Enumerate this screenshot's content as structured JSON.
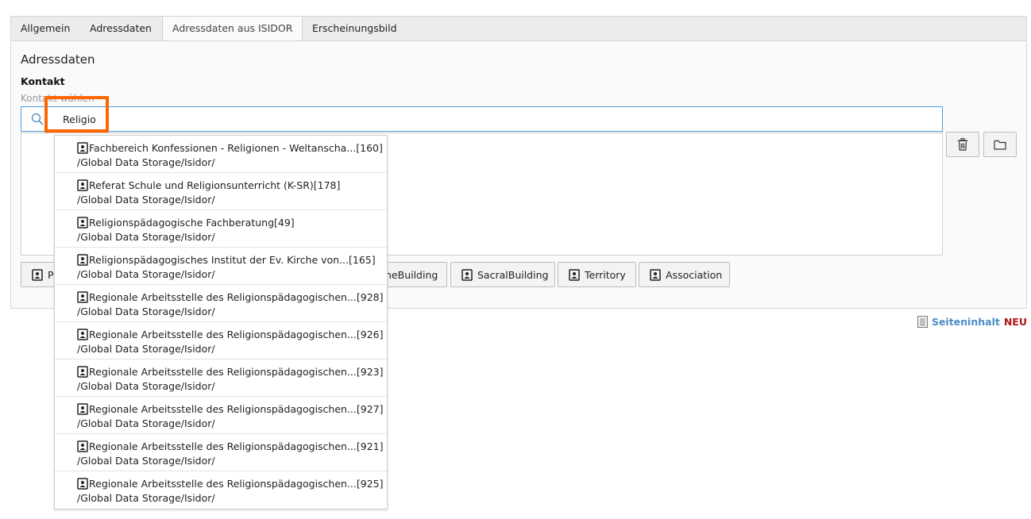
{
  "tabs": [
    {
      "label": "Allgemein"
    },
    {
      "label": "Adressdaten"
    },
    {
      "label": "Adressdaten aus ISIDOR"
    },
    {
      "label": "Erscheinungsbild"
    }
  ],
  "section": {
    "title": "Adressdaten"
  },
  "field": {
    "label": "Kontakt",
    "sublabel": "Kontakt wählen"
  },
  "search": {
    "value": "Religio"
  },
  "side_buttons": [
    {
      "icon": "trash-icon"
    },
    {
      "icon": "folder-icon"
    }
  ],
  "type_buttons": [
    {
      "label": "P"
    },
    {
      "label": "neBuilding"
    },
    {
      "label": "SacralBuilding"
    },
    {
      "label": "Territory"
    },
    {
      "label": "Association"
    }
  ],
  "dropdown": {
    "items": [
      {
        "title": "Fachbereich Konfessionen - Religionen - Weltanscha...[160]",
        "path": "/Global Data Storage/Isidor/"
      },
      {
        "title": "Referat Schule und Religionsunterricht (K-SR)[178]",
        "path": "/Global Data Storage/Isidor/"
      },
      {
        "title": "Religionspädagogische Fachberatung[49]",
        "path": "/Global Data Storage/Isidor/"
      },
      {
        "title": "Religionspädagogisches Institut der Ev. Kirche von...[165]",
        "path": "/Global Data Storage/Isidor/"
      },
      {
        "title": "Regionale Arbeitsstelle des Religionspädagogischen...[928]",
        "path": "/Global Data Storage/Isidor/"
      },
      {
        "title": "Regionale Arbeitsstelle des Religionspädagogischen...[926]",
        "path": "/Global Data Storage/Isidor/"
      },
      {
        "title": "Regionale Arbeitsstelle des Religionspädagogischen...[923]",
        "path": "/Global Data Storage/Isidor/"
      },
      {
        "title": "Regionale Arbeitsstelle des Religionspädagogischen...[927]",
        "path": "/Global Data Storage/Isidor/"
      },
      {
        "title": "Regionale Arbeitsstelle des Religionspädagogischen...[921]",
        "path": "/Global Data Storage/Isidor/"
      },
      {
        "title": "Regionale Arbeitsstelle des Religionspädagogischen...[925]",
        "path": "/Global Data Storage/Isidor/"
      }
    ]
  },
  "footer": {
    "link_label": "Seiteninhalt",
    "badge": "NEU"
  },
  "colors": {
    "accent": "#4c9de0",
    "highlight": "#ff6600",
    "link": "#4c8cc6",
    "badge": "#b01818"
  }
}
